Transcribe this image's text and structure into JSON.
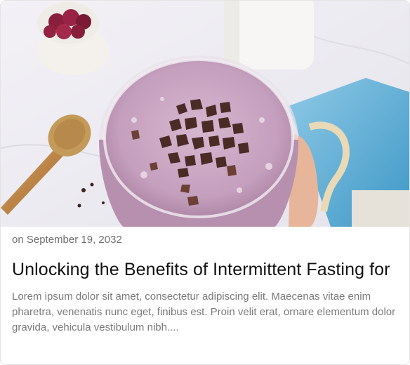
{
  "post": {
    "image_alt": "smoothie-photo",
    "date": "on September 19, 2032",
    "title": "Unlocking the Benefits of Intermittent Fasting for",
    "excerpt": "Lorem ipsum dolor sit amet, consectetur adipiscing elit. Maecenas vitae enim pharetra, venenatis nunc eget, finibus est. Proin velit erat, ornare elementum dolor gravida, vehicula vestibulum nibh...."
  }
}
